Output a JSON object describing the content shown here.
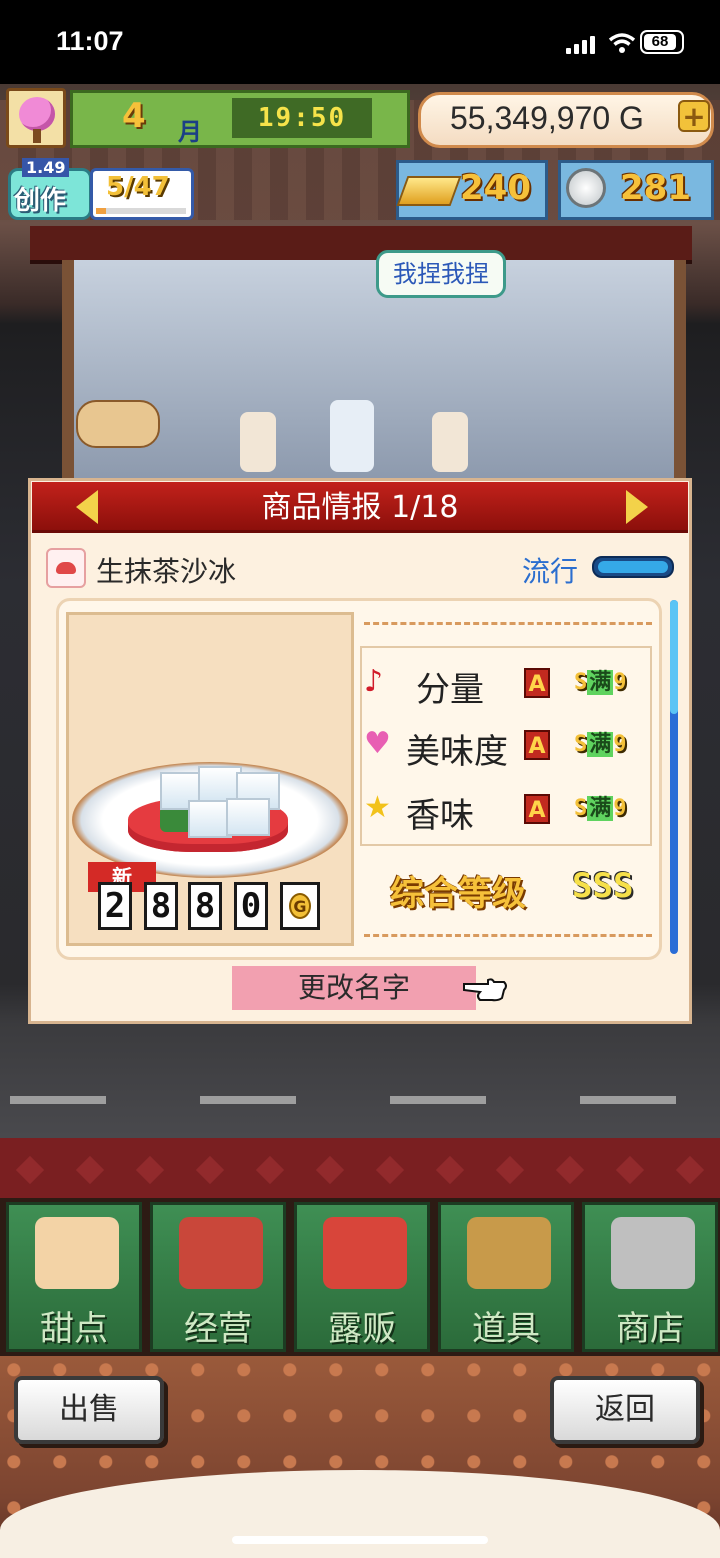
{
  "status_bar": {
    "time": "11:07",
    "battery": "68"
  },
  "hud": {
    "month_number": "4",
    "month_label": "月",
    "clock": "19:50",
    "money": "55,349,970 G",
    "plus_symbol": "+",
    "create_label": "创作",
    "create_level": "1.49",
    "create_count": "5/47",
    "create_progress": 0.11,
    "gold_count": "240",
    "coin_count": "281"
  },
  "speech_bubble": "我捏我捏",
  "panel": {
    "title": "商品情报 1/18",
    "item_name": "生抹茶沙冰",
    "trend_label": "流行",
    "trend_level": 0.95,
    "new_tag": "新",
    "price_digits": [
      "2",
      "8",
      "8",
      "0"
    ],
    "price_currency": "G",
    "stats": [
      {
        "icon": "music-note-icon",
        "glyph": "♪",
        "color": "#d11b2a",
        "label": "分量",
        "grade": "A",
        "max": "满",
        "level": "9"
      },
      {
        "icon": "heart-icon",
        "glyph": "♥",
        "color": "#e85fb3",
        "label": "美味度",
        "grade": "A",
        "max": "满",
        "level": "9"
      },
      {
        "icon": "star-icon",
        "glyph": "★",
        "color": "#f2c21a",
        "label": "香味",
        "grade": "A",
        "max": "满",
        "level": "9"
      }
    ],
    "overall_label": "综合等级",
    "overall_grade": "SSS",
    "rename_button": "更改名字"
  },
  "nav": [
    {
      "label": "甜点",
      "icon": "cake-icon",
      "color": "#f3d3a6"
    },
    {
      "label": "经营",
      "icon": "shop-icon",
      "color": "#c9473a"
    },
    {
      "label": "露贩",
      "icon": "food-truck-icon",
      "color": "#d8453a"
    },
    {
      "label": "道具",
      "icon": "gear-bag-icon",
      "color": "#c89a4a"
    },
    {
      "label": "商店",
      "icon": "shopping-cart-icon",
      "color": "#bfbfbf"
    }
  ],
  "buttons": {
    "sell": "出售",
    "back": "返回"
  }
}
